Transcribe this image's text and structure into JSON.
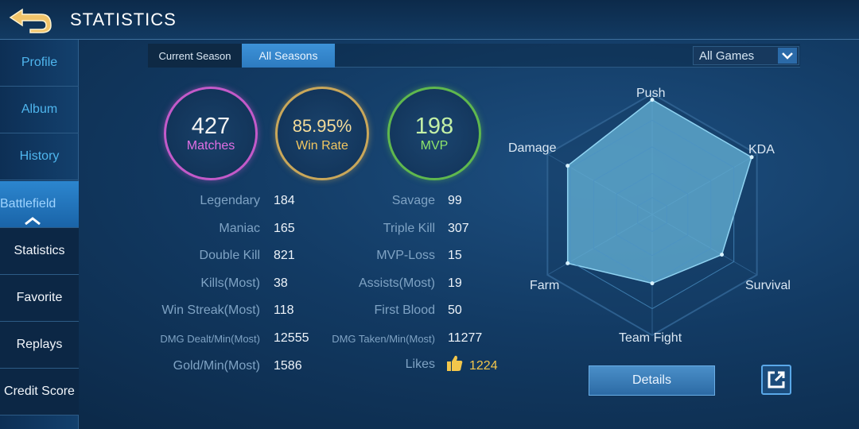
{
  "header": {
    "title": "STATISTICS"
  },
  "sidebar": {
    "items": [
      {
        "label": "Profile"
      },
      {
        "label": "Album"
      },
      {
        "label": "History"
      },
      {
        "label": "Battlefield"
      },
      {
        "label": "Statistics"
      },
      {
        "label": "Favorite"
      },
      {
        "label": "Replays"
      },
      {
        "label": "Credit Score"
      }
    ]
  },
  "tabs": {
    "current_season": "Current Season",
    "all_seasons": "All Seasons"
  },
  "filter": {
    "selected": "All Games"
  },
  "summary": {
    "matches": {
      "value": "427",
      "label": "Matches"
    },
    "win_rate": {
      "value": "85.95%",
      "label": "Win Rate"
    },
    "mvp": {
      "value": "198",
      "label": "MVP"
    }
  },
  "stats_left": [
    {
      "label": "Legendary",
      "value": "184"
    },
    {
      "label": "Maniac",
      "value": "165"
    },
    {
      "label": "Double Kill",
      "value": "821"
    },
    {
      "label": "Kills(Most)",
      "value": "38"
    },
    {
      "label": "Win Streak(Most)",
      "value": "118"
    },
    {
      "label": "DMG Dealt/Min(Most)",
      "value": "12555"
    },
    {
      "label": "Gold/Min(Most)",
      "value": "1586"
    }
  ],
  "stats_right": [
    {
      "label": "Savage",
      "value": "99"
    },
    {
      "label": "Triple Kill",
      "value": "307"
    },
    {
      "label": "MVP-Loss",
      "value": "15"
    },
    {
      "label": "Assists(Most)",
      "value": "19"
    },
    {
      "label": "First Blood",
      "value": "50"
    },
    {
      "label": "DMG Taken/Min(Most)",
      "value": "11277"
    },
    {
      "label": "Likes",
      "value": "1224"
    }
  ],
  "radar": {
    "axes": [
      "Push",
      "KDA",
      "Survival",
      "Team Fight",
      "Farm",
      "Damage"
    ],
    "values": [
      1.0,
      1.0,
      0.7,
      0.6,
      0.85,
      0.85
    ]
  },
  "actions": {
    "details_label": "Details"
  },
  "colors": {
    "matches_ring": "#c35ac9",
    "win_rate_ring": "#c9a75a",
    "mvp_ring": "#5fb84e",
    "radar_fill": "#6ab8dc",
    "likes": "#f3c64b"
  }
}
